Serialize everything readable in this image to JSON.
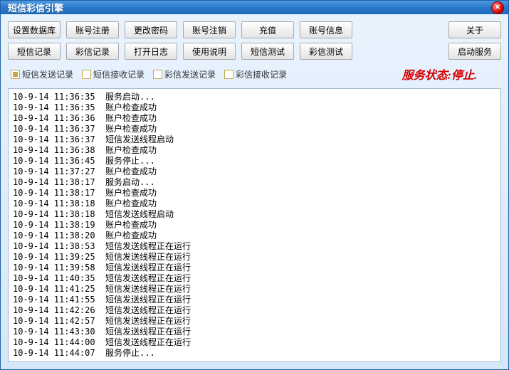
{
  "window": {
    "title": "短信彩信引擎"
  },
  "buttons_row1": [
    {
      "id": "set-db",
      "label": "设置数据库"
    },
    {
      "id": "acct-reg",
      "label": "账号注册"
    },
    {
      "id": "change-pwd",
      "label": "更改密码"
    },
    {
      "id": "acct-cancel",
      "label": "账号注销"
    },
    {
      "id": "recharge",
      "label": "充值"
    },
    {
      "id": "acct-info",
      "label": "账号信息"
    }
  ],
  "buttons_row1_right": [
    {
      "id": "about",
      "label": "关于"
    }
  ],
  "buttons_row2": [
    {
      "id": "sms-log",
      "label": "短信记录"
    },
    {
      "id": "mms-log",
      "label": "彩信记录"
    },
    {
      "id": "open-log",
      "label": "打开日志"
    },
    {
      "id": "usage",
      "label": "使用说明"
    },
    {
      "id": "sms-test",
      "label": "短信测试"
    },
    {
      "id": "mms-test",
      "label": "彩信测试"
    }
  ],
  "buttons_row2_right": [
    {
      "id": "start-service",
      "label": "启动服务"
    }
  ],
  "filters": [
    {
      "id": "sms-send",
      "label": "短信发送记录",
      "checked": true
    },
    {
      "id": "sms-recv",
      "label": "短信接收记录",
      "checked": false
    },
    {
      "id": "mms-send",
      "label": "彩信发送记录",
      "checked": false
    },
    {
      "id": "mms-recv",
      "label": "彩信接收记录",
      "checked": false
    }
  ],
  "status": "服务状态:停止.",
  "log": [
    {
      "ts": "10-9-14 11:36:35",
      "msg": "服务启动..."
    },
    {
      "ts": "10-9-14 11:36:35",
      "msg": "账户检查成功"
    },
    {
      "ts": "10-9-14 11:36:36",
      "msg": "账户检查成功"
    },
    {
      "ts": "10-9-14 11:36:37",
      "msg": "账户检查成功"
    },
    {
      "ts": "10-9-14 11:36:37",
      "msg": "短信发送线程启动"
    },
    {
      "ts": "10-9-14 11:36:38",
      "msg": "账户检查成功"
    },
    {
      "ts": "10-9-14 11:36:45",
      "msg": "服务停止..."
    },
    {
      "ts": "10-9-14 11:37:27",
      "msg": "账户检查成功"
    },
    {
      "ts": "10-9-14 11:38:17",
      "msg": "服务启动..."
    },
    {
      "ts": "10-9-14 11:38:17",
      "msg": "账户检查成功"
    },
    {
      "ts": "10-9-14 11:38:18",
      "msg": "账户检查成功"
    },
    {
      "ts": "10-9-14 11:38:18",
      "msg": "短信发送线程启动"
    },
    {
      "ts": "10-9-14 11:38:19",
      "msg": "账户检查成功"
    },
    {
      "ts": "10-9-14 11:38:20",
      "msg": "账户检查成功"
    },
    {
      "ts": "10-9-14 11:38:53",
      "msg": "短信发送线程正在运行"
    },
    {
      "ts": "10-9-14 11:39:25",
      "msg": "短信发送线程正在运行"
    },
    {
      "ts": "10-9-14 11:39:58",
      "msg": "短信发送线程正在运行"
    },
    {
      "ts": "10-9-14 11:40:35",
      "msg": "短信发送线程正在运行"
    },
    {
      "ts": "10-9-14 11:41:25",
      "msg": "短信发送线程正在运行"
    },
    {
      "ts": "10-9-14 11:41:55",
      "msg": "短信发送线程正在运行"
    },
    {
      "ts": "10-9-14 11:42:26",
      "msg": "短信发送线程正在运行"
    },
    {
      "ts": "10-9-14 11:42:57",
      "msg": "短信发送线程正在运行"
    },
    {
      "ts": "10-9-14 11:43:30",
      "msg": "短信发送线程正在运行"
    },
    {
      "ts": "10-9-14 11:44:00",
      "msg": "短信发送线程正在运行"
    },
    {
      "ts": "10-9-14 11:44:07",
      "msg": "服务停止..."
    }
  ]
}
